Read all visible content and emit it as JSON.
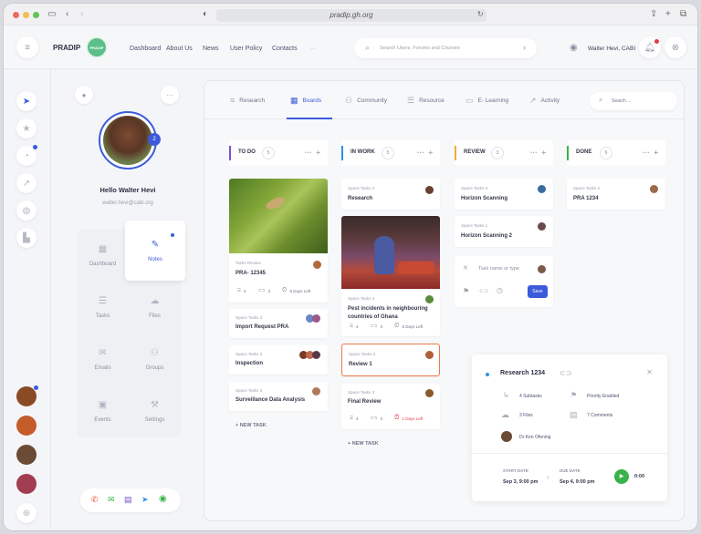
{
  "browser": {
    "url": "pradip.gh.org"
  },
  "header": {
    "brand": "PRADIP",
    "logo_text": "PRADIP",
    "nav": [
      "Dashboard",
      "About Us",
      "News",
      "User Policy",
      "Contacts"
    ],
    "more": "···",
    "search_placeholder": "Search Users, Forums and Courses",
    "user_name": "Walter Hevi, CABI"
  },
  "profile": {
    "badge": "2",
    "greeting": "Hello Walter Hevi",
    "email": "walter.hevi@cabi.org",
    "menu": [
      {
        "label": "Dashboard",
        "icon": "dashboard-icon"
      },
      {
        "label": "Notes",
        "icon": "notes-icon"
      },
      {
        "label": "Tasks",
        "icon": "tasks-icon"
      },
      {
        "label": "Files",
        "icon": "cloud-icon"
      },
      {
        "label": "Emails",
        "icon": "mail-icon"
      },
      {
        "label": "Groups",
        "icon": "groups-icon"
      },
      {
        "label": "Events",
        "icon": "calendar-icon"
      },
      {
        "label": "Settings",
        "icon": "wrench-icon"
      }
    ]
  },
  "tabs": [
    {
      "label": "Research",
      "icon": "research-icon"
    },
    {
      "label": "Boards",
      "icon": "boards-icon"
    },
    {
      "label": "Community",
      "icon": "community-icon"
    },
    {
      "label": "Resource",
      "icon": "resource-icon"
    },
    {
      "label": "E- Learning",
      "icon": "elearning-icon"
    },
    {
      "label": "Activity",
      "icon": "activity-icon"
    }
  ],
  "tab_search_placeholder": "Search ...",
  "columns": [
    {
      "title": "TO DO",
      "count": "5",
      "color": "#7b4fd6"
    },
    {
      "title": "IN WORK",
      "count": "5",
      "color": "#2f8fe6"
    },
    {
      "title": "REVIEW",
      "count": "3",
      "color": "#f2a93b"
    },
    {
      "title": "DONE",
      "count": "6",
      "color": "#38b24a"
    }
  ],
  "todo": {
    "c1": {
      "sub": "Tasks Review",
      "title": "PRA- 12345",
      "checks": "4",
      "comments": "3",
      "days": "6 Days Left"
    },
    "c2": {
      "sub": "Space Tasks 3",
      "title": "Import Request  PRA"
    },
    "c3": {
      "sub": "Space Tasks 3",
      "title": "Inspection"
    },
    "c4": {
      "sub": "Space Tasks 3",
      "title": "Surveillance Data Analysis"
    },
    "new_task": "+ NEW TASK"
  },
  "inwork": {
    "c1": {
      "sub": "Space Tasks 3",
      "title": "Research"
    },
    "c2": {
      "sub": "Space Tasks 3",
      "title": "Pest incidents in neighbouring countries of Ghana",
      "checks": "4",
      "comments": "3",
      "days": "6 Days Left"
    },
    "c3": {
      "sub": "Space Tasks 3",
      "title": "Review 1"
    },
    "c4": {
      "sub": "Space Tasks 3",
      "title": "Final Review",
      "checks": "4",
      "comments": "3",
      "days": "1 Days Left"
    },
    "new_task": "+ NEW TASK"
  },
  "review": {
    "c1": {
      "sub": "Space Tasks 3",
      "title": "Horizon Scanning"
    },
    "c2": {
      "sub": "Space Tasks 1",
      "title": "Horizon Scanning 2"
    },
    "form": {
      "placeholder": "Task name or type",
      "save": "Save"
    }
  },
  "done": {
    "c1": {
      "sub": "Space Tasks 2",
      "title": "PRA 1234"
    }
  },
  "detail": {
    "title": "Research 1234",
    "subtasks": "4 Subtasks",
    "priority": "Priority Enabled",
    "files": "3 Files",
    "comments": "7 Comments",
    "person": "Dr Ken Ofening",
    "start_label": "START DATE",
    "start": "Sep 3, 9:00 pm",
    "due_label": "DUE DATE",
    "due": "Sep 4, 9:00 pm",
    "timer": "0:00"
  }
}
